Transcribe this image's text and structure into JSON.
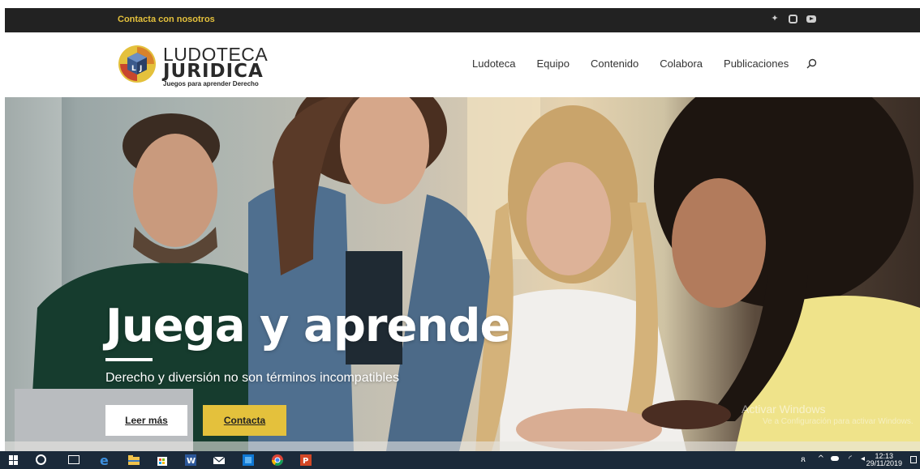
{
  "topbar": {
    "contact_label": "Contacta con nosotros",
    "social": [
      "twitter-icon",
      "instagram-icon",
      "youtube-icon"
    ]
  },
  "logo": {
    "line1": "LUDOTECA",
    "line2": "JURIDICA",
    "tagline": "Juegos para aprender Derecho",
    "mark_letters": "LJ"
  },
  "nav": {
    "items": [
      "Ludoteca",
      "Equipo",
      "Contenido",
      "Colabora",
      "Publicaciones"
    ],
    "search_icon": "search-icon"
  },
  "hero": {
    "title": "Juega y aprende",
    "subtitle": "Derecho y diversión no son términos incompatibles",
    "button_primary": "Leer más",
    "button_secondary": "Contacta"
  },
  "watermark": {
    "line1": "Activar Windows",
    "line2": "Ve a Configuración para activar Windows."
  },
  "taskbar": {
    "time": "12:13",
    "date": "29/11/2019"
  },
  "colors": {
    "accent": "#e4c13c",
    "topbar_bg": "#222222",
    "taskbar_bg": "#1b2a3a"
  }
}
